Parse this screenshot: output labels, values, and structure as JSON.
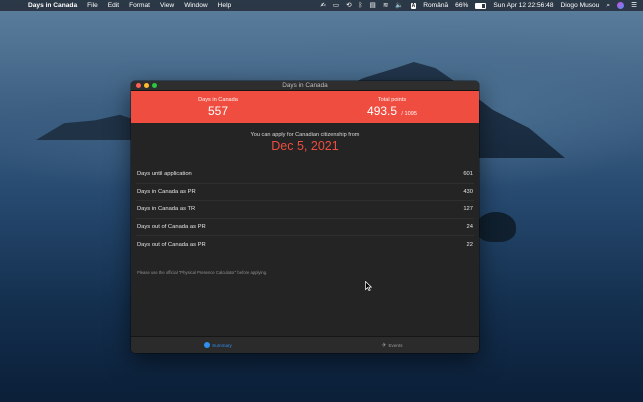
{
  "menubar": {
    "apple_icon": "apple-logo-icon",
    "app_name": "Days in Canada",
    "menus": [
      "File",
      "Edit",
      "Format",
      "View",
      "Window",
      "Help"
    ],
    "status": {
      "keyboard_badge": "A",
      "input_source": "Română",
      "battery_percent": "66%",
      "battery_level": 0.66,
      "datetime": "Sun Apr 12  22:56:48",
      "user": "Diogo Musou"
    }
  },
  "window": {
    "title": "Days in Canada",
    "hero": {
      "days_label": "Days in Canada",
      "days_value": "557",
      "points_label": "Total points",
      "points_value": "493.5",
      "points_of": "/ 1095",
      "accent": "#ef4d3f"
    },
    "apply_text": "You can apply for Canadian citizenship from",
    "apply_date": "Dec 5, 2021",
    "stats": [
      {
        "label": "Days until application",
        "value": "601"
      },
      {
        "label": "Days in Canada as PR",
        "value": "430"
      },
      {
        "label": "Days in Canada as TR",
        "value": "127"
      },
      {
        "label": "Days out of Canada as PR",
        "value": "24"
      },
      {
        "label": "Days out of Canada as PR",
        "value": "22"
      }
    ],
    "note": "Please use the official \"Physical Presence Calculator\" before applying.",
    "tabs": [
      {
        "label": "Summary",
        "icon": "summary-icon",
        "active": true
      },
      {
        "label": "Events",
        "icon": "plane-icon",
        "active": false
      }
    ]
  }
}
